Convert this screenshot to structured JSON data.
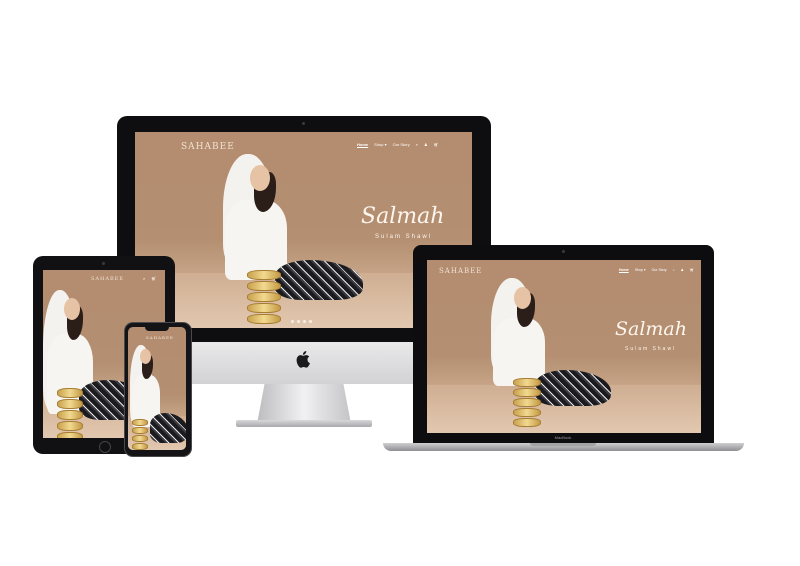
{
  "site": {
    "logo": "SAHABEE",
    "nav": [
      "Home",
      "Shop ▾",
      "Our Story"
    ],
    "icons": [
      "search-icon",
      "user-icon",
      "cart-icon"
    ],
    "hero_title": "Salmah",
    "hero_subtitle": "Sulam Shawl"
  },
  "macbook": {
    "label": "MacBook"
  },
  "colors": {
    "hero_bg": "#b48c6f",
    "hood": "#f4f2ef",
    "bezel": "#0e0e10"
  }
}
